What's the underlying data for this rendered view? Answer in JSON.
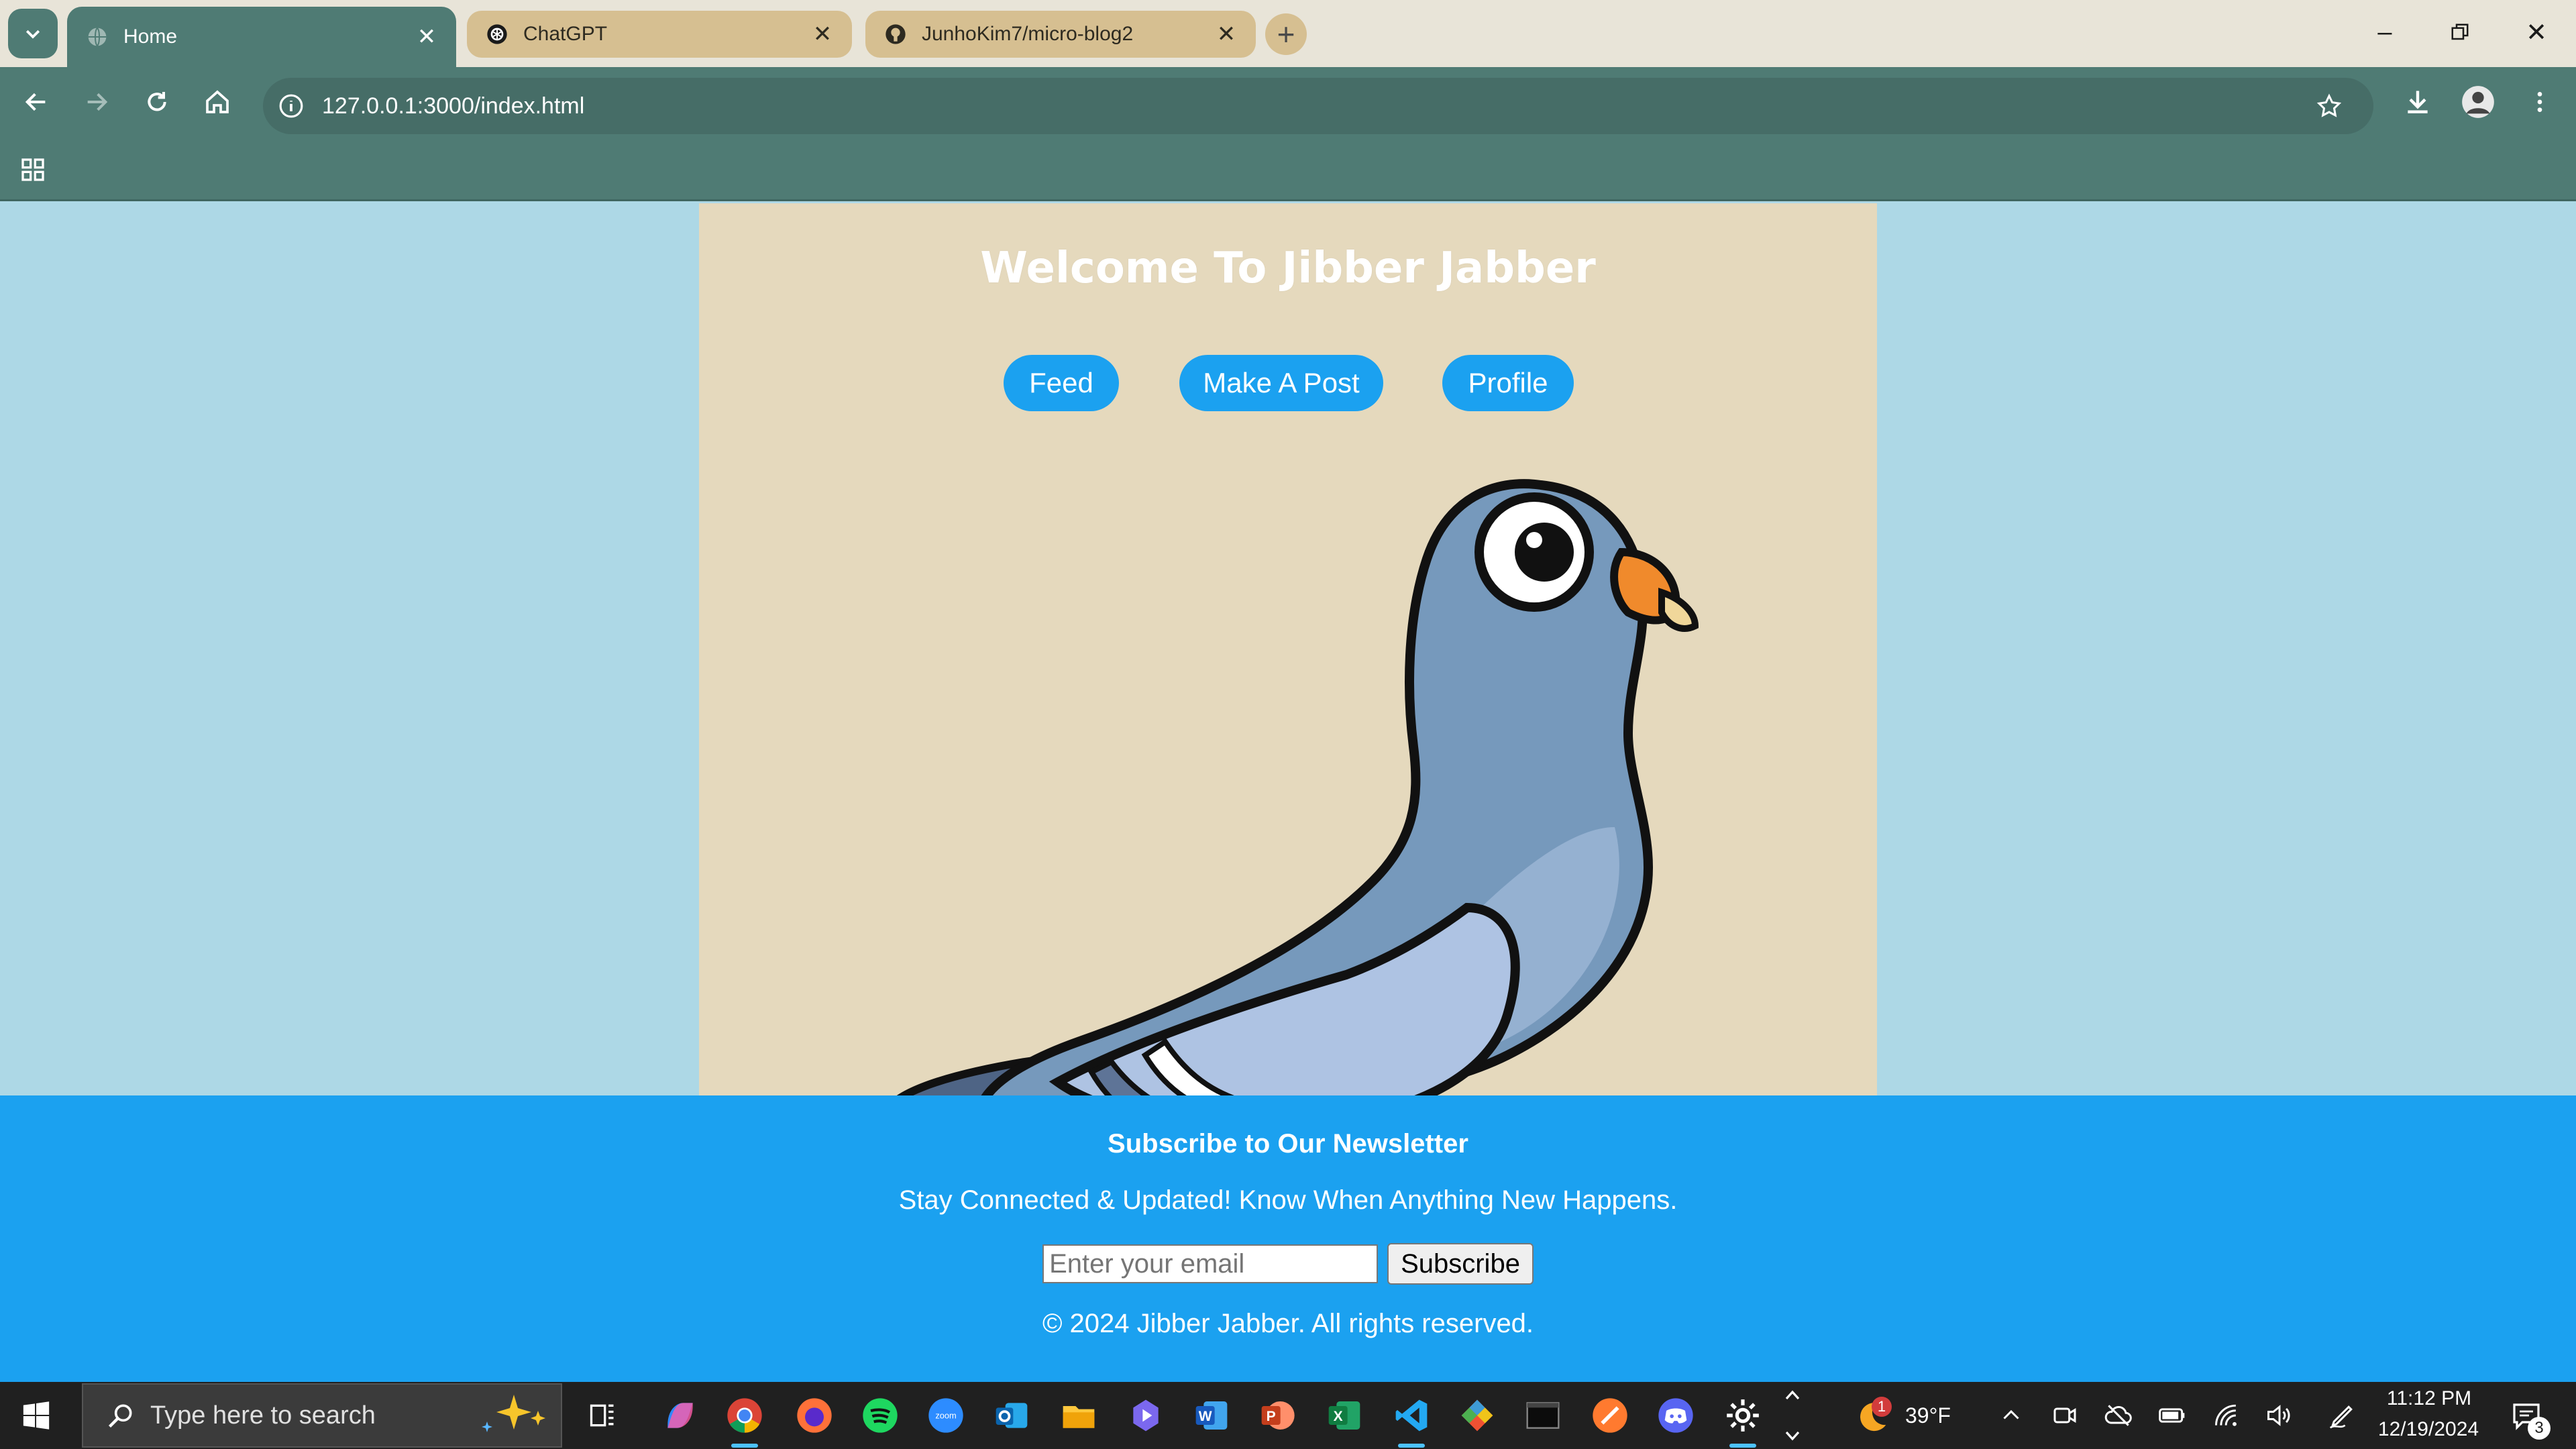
{
  "browser": {
    "tabs": [
      {
        "title": "Home",
        "active": true
      },
      {
        "title": "ChatGPT",
        "active": false
      },
      {
        "title": "JunhoKim7/micro-blog2",
        "active": false
      }
    ],
    "url": "127.0.0.1:3000/index.html",
    "colors": {
      "frame": "#4f7b74",
      "tab_inactive": "#d6bf91"
    }
  },
  "page": {
    "title": "Welcome To Jibber Jabber",
    "nav": {
      "feed": "Feed",
      "make_post": "Make A Post",
      "profile": "Profile"
    },
    "newsletter": {
      "title": "Subscribe to Our Newsletter",
      "subtitle": "Stay Connected & Updated! Know When Anything New Happens.",
      "email_placeholder": "Enter your email",
      "subscribe_label": "Subscribe",
      "copyright": "© 2024 Jibber Jabber. All rights reserved."
    },
    "colors": {
      "background": "#add8e6",
      "hero": "#e5d9bd",
      "accent": "#1ba1f0"
    }
  },
  "taskbar": {
    "search_placeholder": "Type here to search",
    "weather": "39°F",
    "weather_badge": "1",
    "time": "11:12 PM",
    "date": "12/19/2024",
    "notifications": "3",
    "pinned": [
      "task-view-icon",
      "copilot-icon",
      "chrome-icon",
      "firefox-icon",
      "spotify-icon",
      "zoom-icon",
      "outlook-icon",
      "file-explorer-icon",
      "clipchamp-icon",
      "word-icon",
      "powerpoint-icon",
      "excel-icon",
      "vscode-icon",
      "git-icon",
      "terminal-icon",
      "sketch-icon",
      "discord-icon",
      "settings-icon"
    ]
  }
}
